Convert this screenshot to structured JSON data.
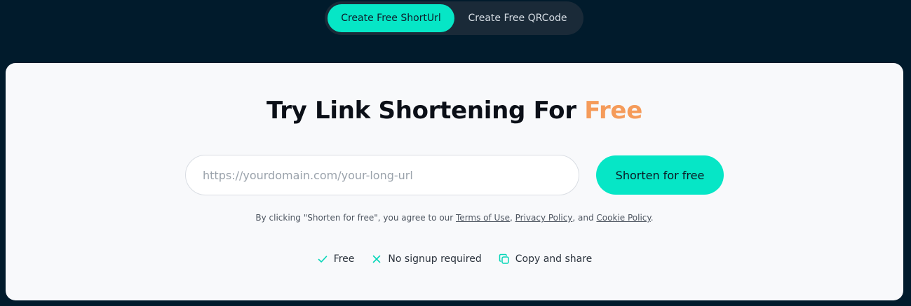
{
  "tabs": [
    {
      "label": "Create Free ShortUrl",
      "active": true
    },
    {
      "label": "Create Free QRCode",
      "active": false
    }
  ],
  "hero": {
    "title_main": "Try Link Shortening For ",
    "title_accent": "Free"
  },
  "form": {
    "url_placeholder": "https://yourdomain.com/your-long-url",
    "url_value": "",
    "submit_label": "Shorten for free"
  },
  "terms": {
    "prefix": "By clicking \"Shorten for free\", you agree to our ",
    "terms_link": "Terms of Use",
    "sep1": ", ",
    "privacy_link": "Privacy Policy",
    "sep2": ", and ",
    "cookie_link": "Cookie Policy",
    "suffix": "."
  },
  "features": [
    {
      "icon": "check-icon",
      "label": "Free"
    },
    {
      "icon": "x-icon",
      "label": "No signup required"
    },
    {
      "icon": "copy-icon",
      "label": "Copy and share"
    }
  ],
  "colors": {
    "background": "#011b2c",
    "accent_teal": "#06e6c6",
    "accent_orange": "#f59b5a",
    "card": "#f8f9fb"
  }
}
